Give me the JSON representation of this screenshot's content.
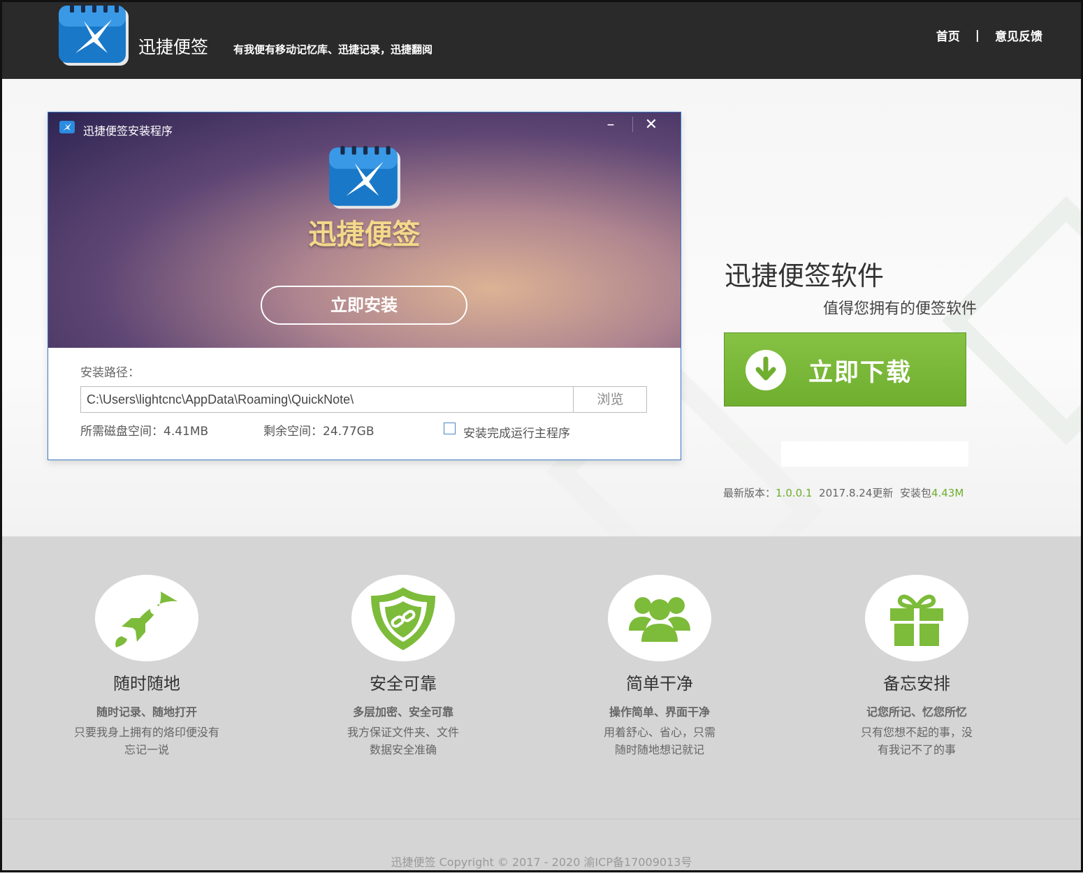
{
  "header": {
    "brand": "迅捷便签",
    "slogan": "有我便有移动记忆库、迅捷记录，迅捷翻阅",
    "nav": {
      "home": "首页",
      "separator": "|",
      "feedback": "意见反馈"
    }
  },
  "installer": {
    "window_title": "迅捷便签安装程序",
    "minimize": "–",
    "close": "✕",
    "app_name": "迅捷便签",
    "install_button": "立即安装",
    "path_label": "安装路径：",
    "path_value": "C:\\Users\\lightcnc\\AppData\\Roaming\\QuickNote\\",
    "browse_button": "浏览",
    "disk_required": "所需磁盘空间：4.41MB",
    "disk_free": "剩余空间：24.77GB",
    "run_after_install": "安装完成运行主程序"
  },
  "download": {
    "title": "迅捷便签软件",
    "subtitle": "值得您拥有的便签软件",
    "button": "立即下载",
    "version_label": "最新版本：",
    "version": "1.0.0.1",
    "update_date": "2017.8.24更新",
    "package_label": "安装包",
    "package_size": "4.43M"
  },
  "features": [
    {
      "icon": "rocket-icon",
      "title": "随时随地",
      "subtitle": "随时记录、随地打开",
      "desc1": "只要我身上拥有的烙印便没有",
      "desc2": "忘记一说"
    },
    {
      "icon": "shield-icon",
      "title": "安全可靠",
      "subtitle": "多层加密、安全可靠",
      "desc1": "我方保证文件夹、文件",
      "desc2": "数据安全准确"
    },
    {
      "icon": "users-icon",
      "title": "简单干净",
      "subtitle": "操作简单、界面干净",
      "desc1": "用着舒心、省心，只需",
      "desc2": "随时随地想记就记"
    },
    {
      "icon": "gift-icon",
      "title": "备忘安排",
      "subtitle": "记您所记、忆您所忆",
      "desc1": "只有您想不起的事，没",
      "desc2": "有我记不了的事"
    }
  ],
  "footer": {
    "copyright": "迅捷便签 Copyright © 2017 - 2020 渝ICP备17009013号"
  },
  "colors": {
    "header_bg": "#2a2a2a",
    "accent_green": "#6fae2f",
    "feature_bg": "#d5d5d5",
    "gold_text": "#f3d98a"
  }
}
